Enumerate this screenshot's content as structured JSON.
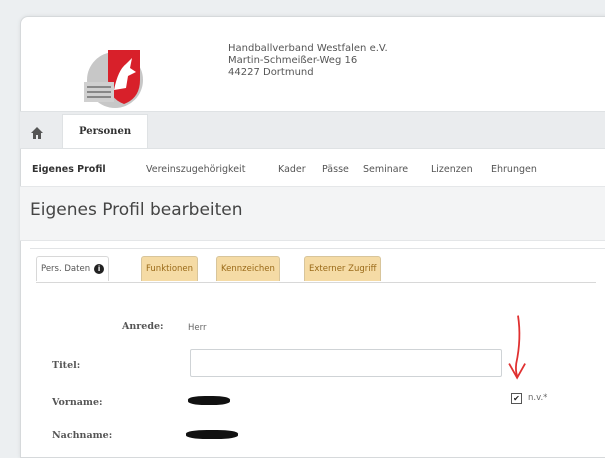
{
  "org": {
    "name": "Handballverband Westfalen e.V.",
    "street": "Martin-Schmeißer-Weg 16",
    "city": "44227 Dortmund"
  },
  "main_tabs": {
    "home_icon": "home-icon",
    "personen": "Personen"
  },
  "subnav": [
    "Eigenes Profil",
    "Vereinszugehörigkeit",
    "Kader",
    "Pässe",
    "Seminare",
    "Lizenzen",
    "Ehrungen"
  ],
  "page_title": "Eigenes Profil bearbeiten",
  "form_tabs": [
    "Pers. Daten",
    "Funktionen",
    "Kennzeichen",
    "Externer Zugriff"
  ],
  "form": {
    "anrede_label": "Anrede:",
    "anrede_value": "Herr",
    "titel_label": "Titel:",
    "titel_value": "",
    "vorname_label": "Vorname:",
    "nachname_label": "Nachname:",
    "nv_label": "n.v.*",
    "nv_checked": true
  },
  "colors": {
    "annotation_arrow": "#e03030",
    "tab_inactive_bg": "#f5dba5"
  }
}
